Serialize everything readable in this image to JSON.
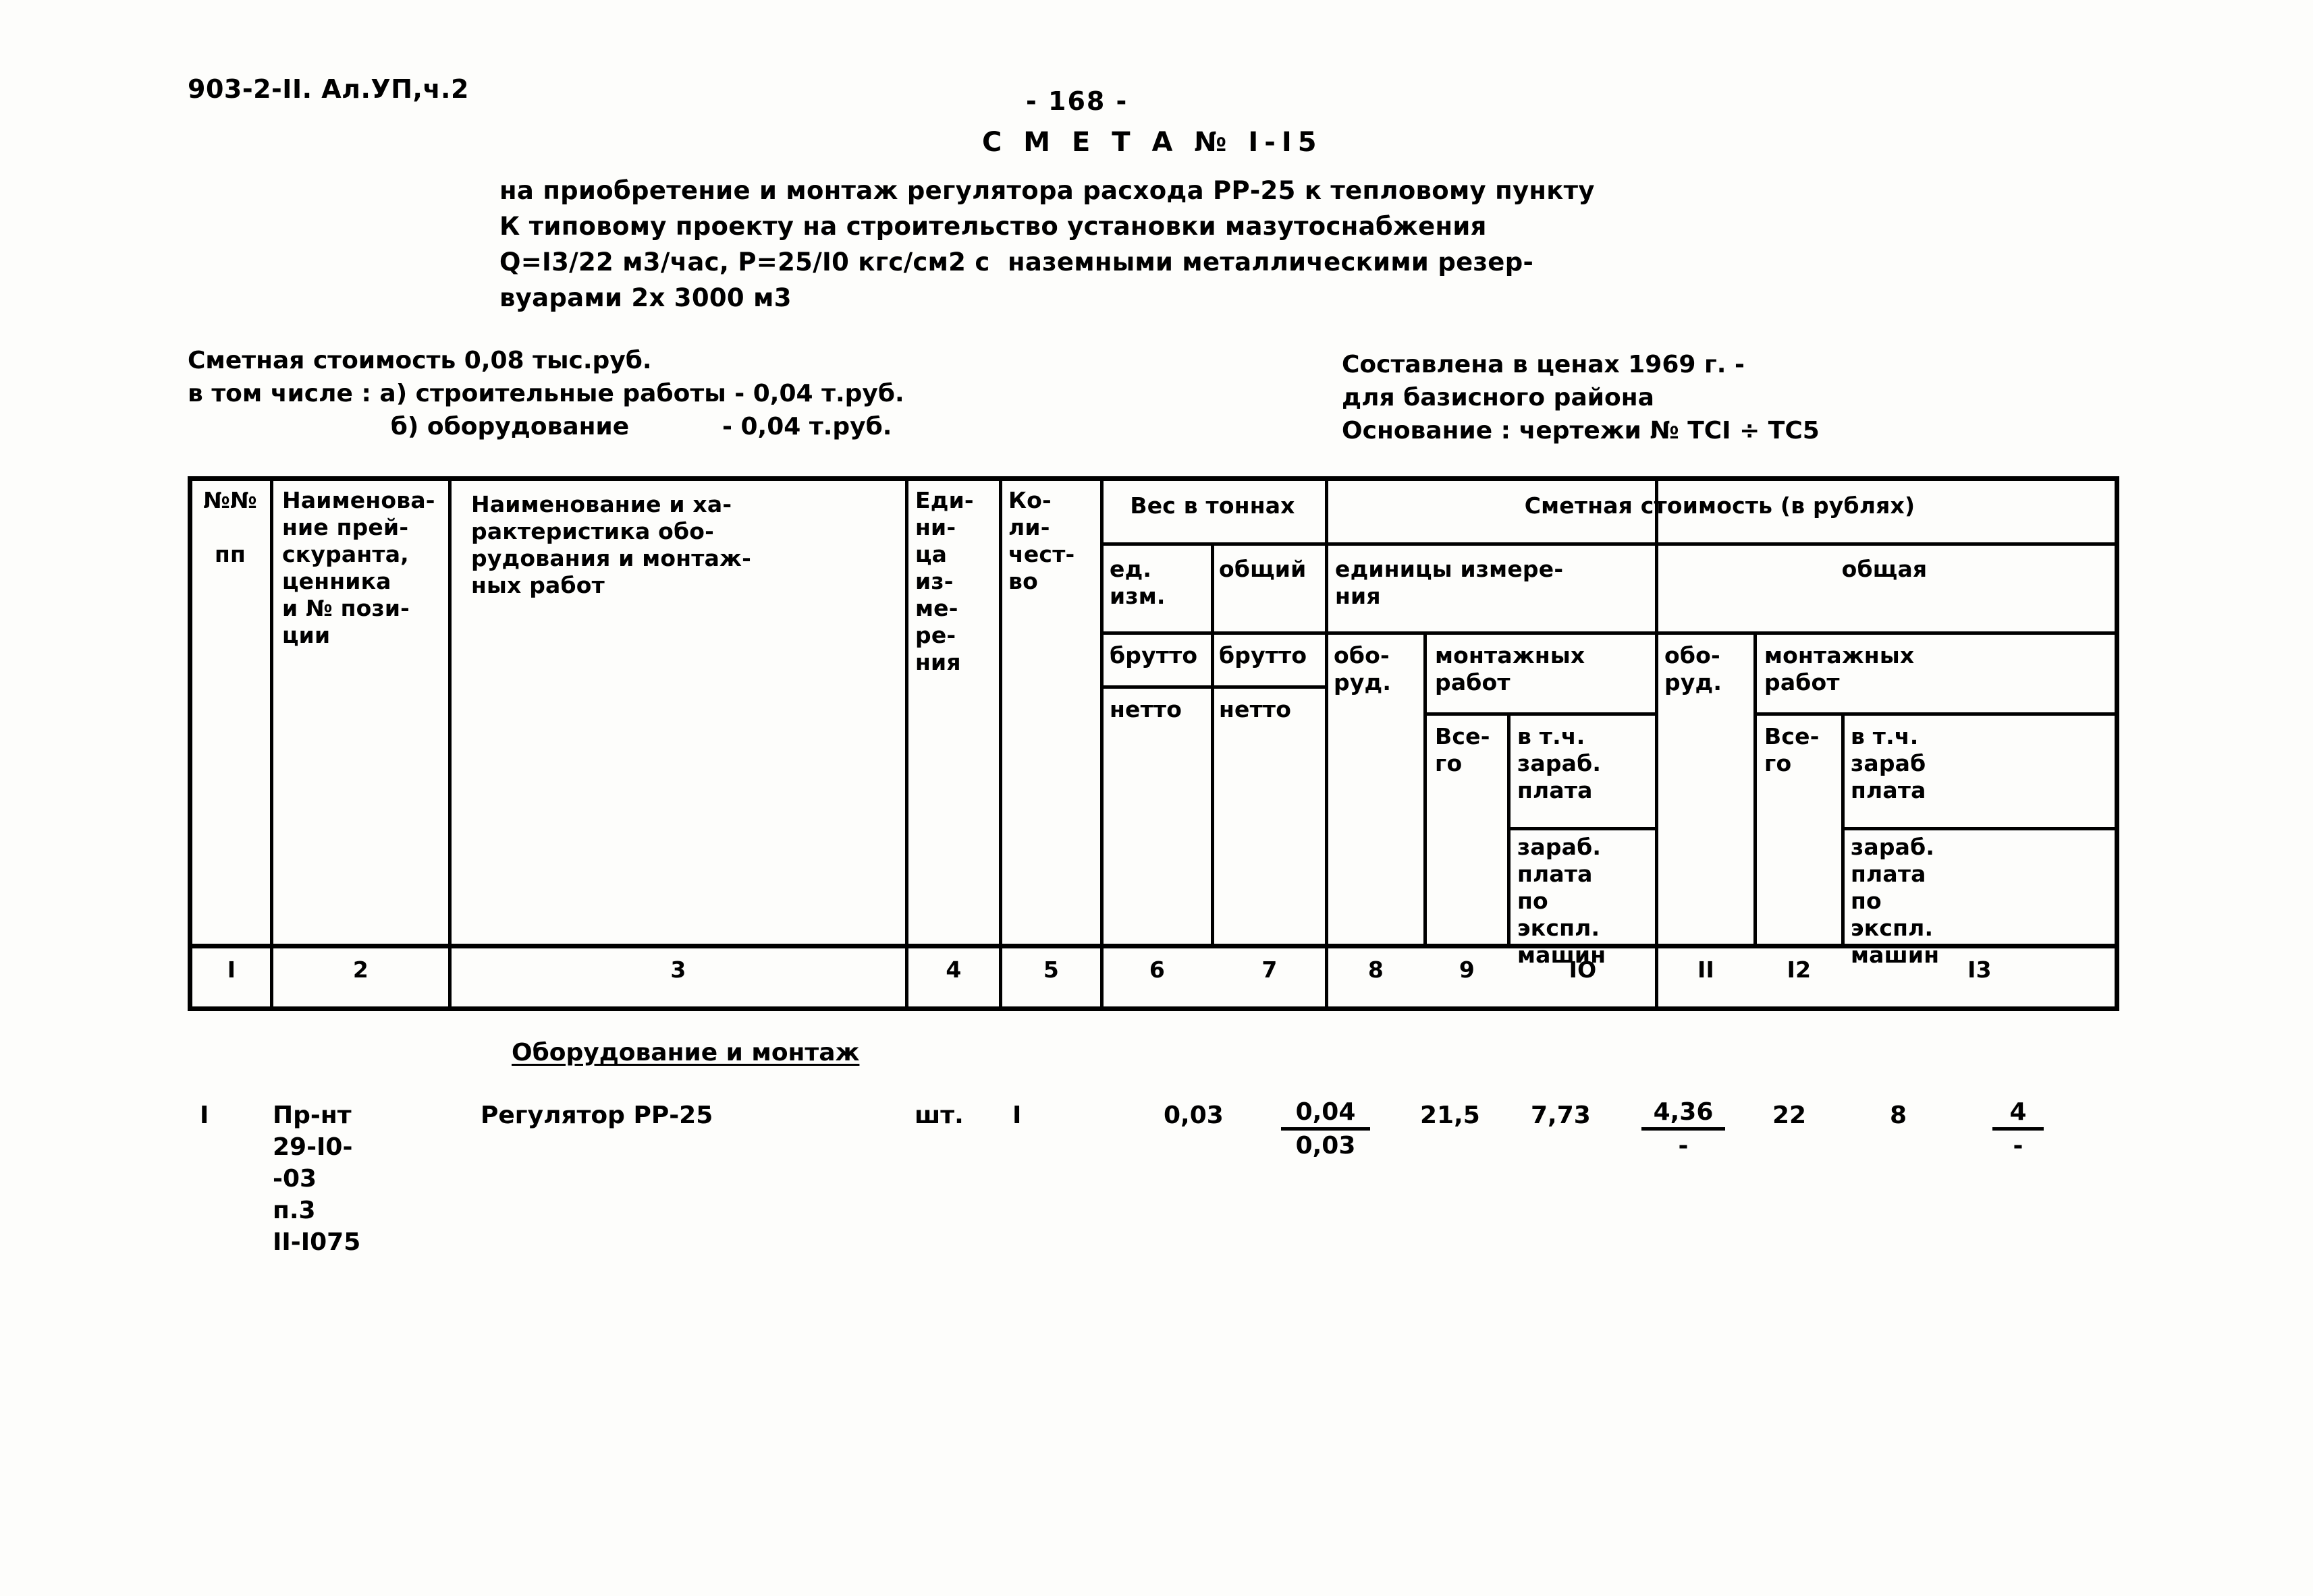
{
  "header": {
    "doc_code": "903-2-II. Ал.УП,ч.2",
    "page_number": "- 168 -",
    "title": "С М Е Т А № I-I5"
  },
  "description": {
    "line1": "на приобретение и монтаж регулятора расхода РР-25 к тепловому пункту",
    "line2": "К типовому проекту на строительство установки мазутоснабжения",
    "line3": "Q=I3/22 м3/час, Р=25/I0 кгс/см2 с  наземными металлическими резер-",
    "line4": "вуарами 2х 3000 м3"
  },
  "summary_left": {
    "line1": "Сметная стоимость 0,08 тыс.руб.",
    "line2": "в том числе : а) строительные работы - 0,04 т.руб.",
    "line3": "                        б) оборудование           - 0,04 т.руб."
  },
  "summary_right": {
    "line1": "Составлена в ценах 1969 г. -",
    "line2": "для базисного района",
    "line3": "Основание : чертежи № ТСI ÷ ТС5"
  },
  "table": {
    "headers": {
      "col1": "№№\n\nпп",
      "col2": "Наименова-\nние прей-\nскуранта,\nценника\nи № пози-\nции",
      "col3": "Наименование и ха-\nрактеристика обо-\nрудования и монтаж-\nных работ",
      "col4": "Еди-\nни-\nца\nиз-\nме-\nре-\nния",
      "col5": "Ко-\nли-\nчест-\nво",
      "weight_group": "Вес в тоннах",
      "weight_unit": "ед.\nизм.",
      "weight_total": "общий",
      "brutto_unit": "брутто",
      "netto_unit": "нетто",
      "brutto_total": "брутто",
      "netto_total": "нетто",
      "cost_group": "Сметная стоимость (в рублях)",
      "cost_per_unit": "единицы измере-\n      ния",
      "cost_total": "общая",
      "equip_per_unit": "обо-\nруд.",
      "install_per_unit": "монтажных\n    работ",
      "equip_total": "обо-\nруд.",
      "install_total": "монтажных\n  работ",
      "total_label_1": "Все-\nго",
      "incl_wage_1": "в т.ч.\nзараб.\nплата",
      "machine_wage_1": "зараб.\nплата\nпо\nэкспл.\nмашин",
      "total_label_2": "Все-\nго",
      "incl_wage_2": "в т.ч.\nзараб\nплата",
      "machine_wage_2": "зараб.\nплата\nпо\nэкспл.\nмашин"
    },
    "column_numbers": [
      "I",
      "2",
      "3",
      "4",
      "5",
      "6",
      "7",
      "8",
      "9",
      "IO",
      "II",
      "I2",
      "I3"
    ],
    "section_title": "Оборудование и монтаж",
    "rows": [
      {
        "num": "I",
        "price_list": "Пр-нт\n29-I0-\n-03\nп.3\nII-I075",
        "name": "Регулятор РР-25",
        "unit": "шт.",
        "qty": "I",
        "weight_unit_brutto": "0,03",
        "weight_unit_netto": "",
        "weight_total_brutto": "0,04",
        "weight_total_netto": "0,03",
        "cost_equip_unit": "21,5",
        "cost_install_total_unit": "7,73",
        "cost_install_wage_unit": "4,36",
        "cost_install_machine_unit": "-",
        "cost_equip_total": "22",
        "cost_install_total": "8",
        "cost_install_wage_total": "4",
        "cost_install_machine_total": "-"
      }
    ]
  }
}
